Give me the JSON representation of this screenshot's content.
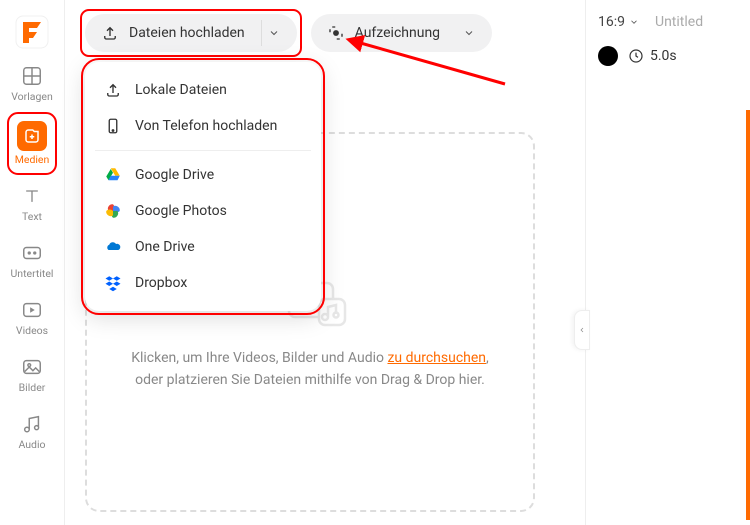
{
  "sidebar": {
    "items": [
      {
        "label": "Vorlagen"
      },
      {
        "label": "Medien"
      },
      {
        "label": "Text"
      },
      {
        "label": "Untertitel"
      },
      {
        "label": "Videos"
      },
      {
        "label": "Bilder"
      },
      {
        "label": "Audio"
      }
    ]
  },
  "toolbar": {
    "upload_label": "Dateien hochladen",
    "record_label": "Aufzeichnung"
  },
  "dropdown": {
    "local": "Lokale Dateien",
    "phone": "Von Telefon hochladen",
    "gdrive": "Google Drive",
    "gphotos": "Google Photos",
    "onedrive": "One Drive",
    "dropbox": "Dropbox"
  },
  "dropzone": {
    "prefix": "Klicken, um Ihre Videos, Bilder und Audio ",
    "link": "zu durchsuchen",
    "suffix": ", oder platzieren Sie Dateien mithilfe von Drag & Drop hier."
  },
  "right": {
    "aspect": "16:9",
    "title": "Untitled",
    "duration": "5.0s"
  }
}
